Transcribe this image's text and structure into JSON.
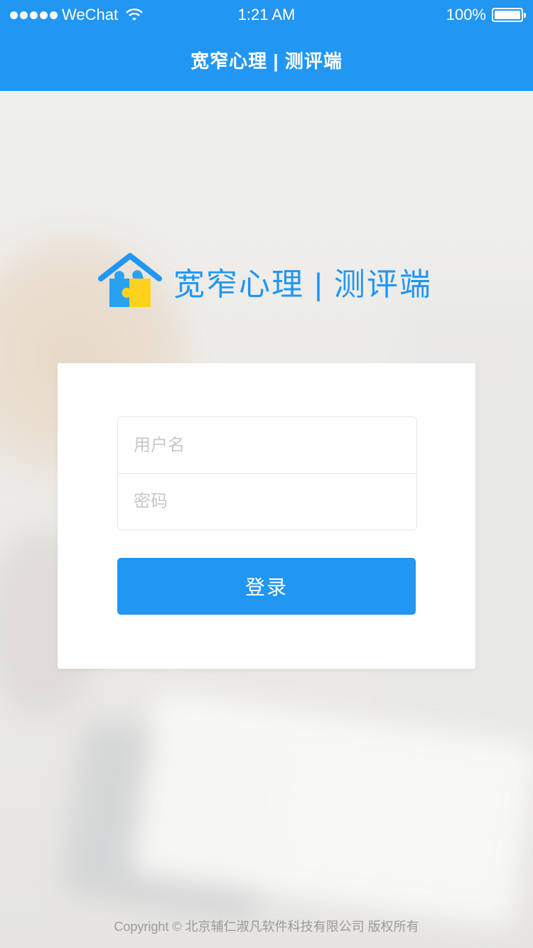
{
  "status_bar": {
    "carrier": "WeChat",
    "time": "1:21 AM",
    "battery": "100%"
  },
  "header": {
    "title": "宽窄心理 | 测评端"
  },
  "logo": {
    "text": "宽窄心理 | 测评端",
    "colors": {
      "roof": "#2196f3",
      "piece_blue": "#2aa0f0",
      "piece_yellow": "#ffd21e"
    }
  },
  "login_form": {
    "username_placeholder": "用户名",
    "password_placeholder": "密码",
    "submit_label": "登录"
  },
  "footer": {
    "copyright": "Copyright © 北京辅仁淑凡软件科技有限公司 版权所有"
  },
  "colors": {
    "accent": "#2196f3",
    "footer_text": "#9a9a9a"
  }
}
